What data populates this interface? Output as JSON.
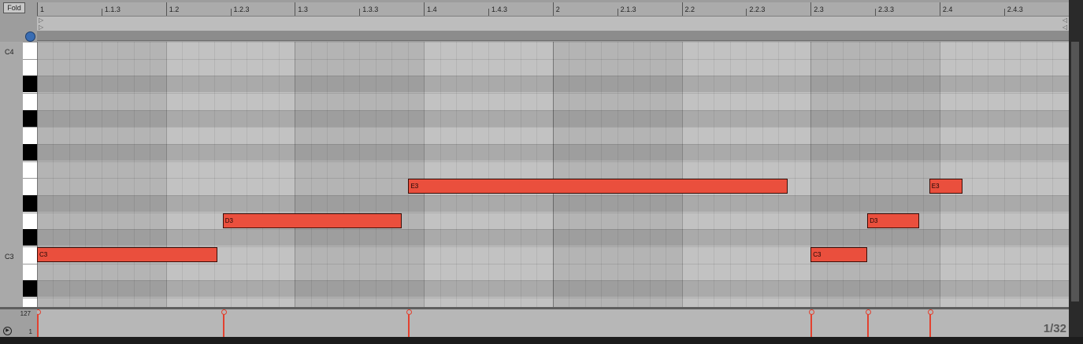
{
  "header": {
    "fold_label": "Fold"
  },
  "ruler": {
    "labels": [
      "1",
      "1.1.3",
      "1.2",
      "1.2.3",
      "1.3",
      "1.3.3",
      "1.4",
      "1.4.3",
      "2",
      "2.1.3",
      "2.2",
      "2.2.3",
      "2.3",
      "2.3.3",
      "2.4",
      "2.4.3"
    ]
  },
  "keyboard": {
    "labels": [
      "C4",
      "C3"
    ]
  },
  "notes": [
    {
      "pitch": "C3",
      "start_beat": 0.0,
      "length_beats": 1.4
    },
    {
      "pitch": "D3",
      "start_beat": 1.44,
      "length_beats": 1.39
    },
    {
      "pitch": "E3",
      "start_beat": 2.88,
      "length_beats": 2.94
    },
    {
      "pitch": "C3",
      "start_beat": 6.0,
      "length_beats": 0.44
    },
    {
      "pitch": "D3",
      "start_beat": 6.44,
      "length_beats": 0.4
    },
    {
      "pitch": "E3",
      "start_beat": 6.92,
      "length_beats": 0.26
    }
  ],
  "velocity": {
    "max_label": "127",
    "min_label": "1"
  },
  "grid": {
    "quantization": "1/32"
  },
  "colors": {
    "note": "#ea4f3d",
    "note_border": "#3b0d07",
    "grid_bg": "#b4b4b4",
    "beat_band": "#c2c2c2"
  }
}
